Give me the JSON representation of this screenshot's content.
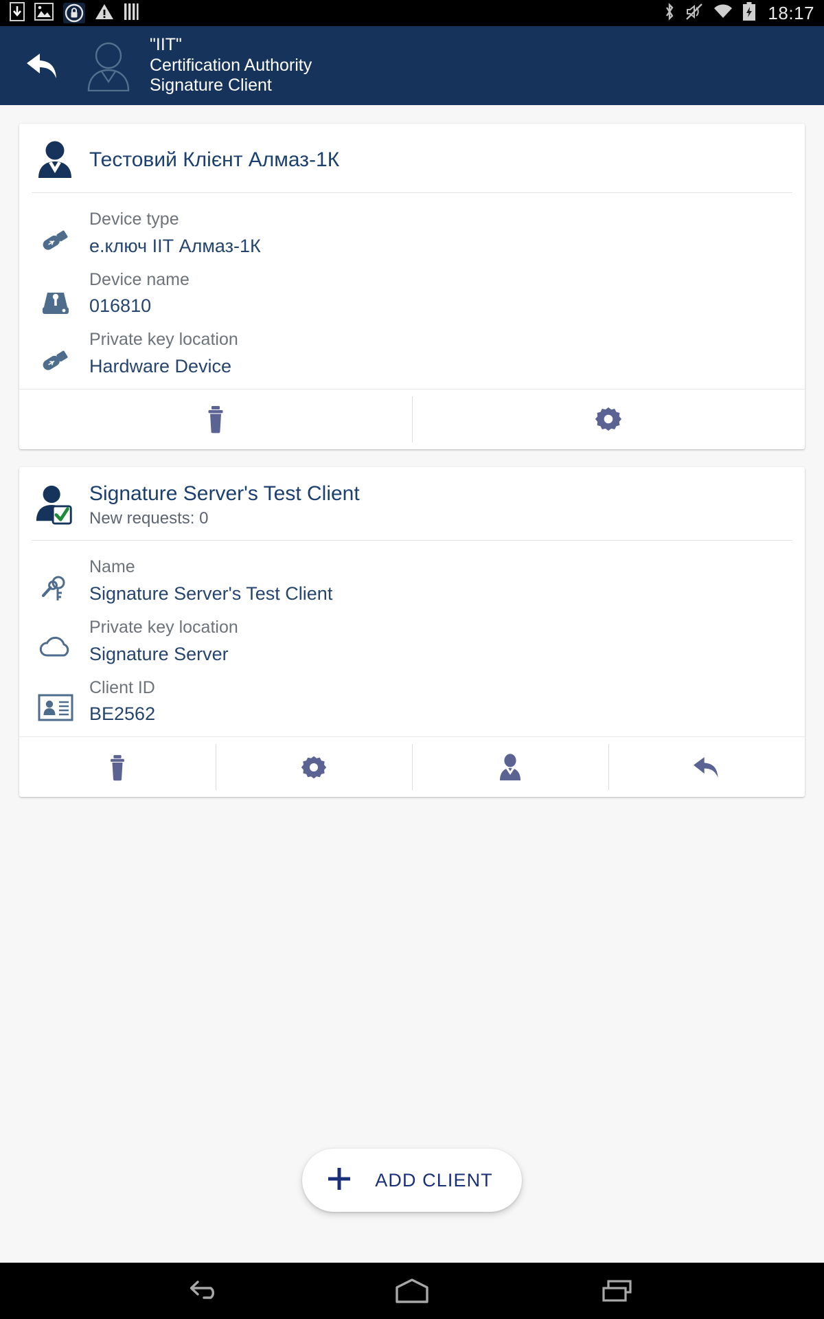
{
  "status_bar": {
    "time": "18:17",
    "left_icons": [
      "download-icon",
      "image-icon",
      "lock-icon",
      "warning-icon",
      "bars-icon"
    ],
    "right_icons": [
      "bluetooth-icon",
      "volume-muted-icon",
      "wifi-icon",
      "battery-charging-icon"
    ]
  },
  "app_bar": {
    "back_icon": "back-arrow-icon",
    "avatar_icon": "person-outline-icon",
    "title_line1": "\"IIT\"",
    "title_line2": "Certification Authority",
    "title_line3": "Signature Client"
  },
  "colors": {
    "app_bar": "#16335c",
    "page_background": "#f7f7f7",
    "card_background": "#ffffff",
    "title_blue": "#1b3f6e",
    "value_blue": "#25456e",
    "label_gray": "#6d737b",
    "action_icon": "#5a6391",
    "accent_blue": "#1a2f7a",
    "check_green": "#1e8a3c"
  },
  "cards": [
    {
      "id": "hardware-client-card",
      "icon": "person-filled-icon",
      "title": "Тестовий Клієнт Алмаз-1К",
      "subtitle": "",
      "rows": [
        {
          "icon": "usb-token-icon",
          "label": "Device type",
          "value": "е.ключ ІІТ Алмаз-1К"
        },
        {
          "icon": "key-drive-icon",
          "label": "Device name",
          "value": "016810"
        },
        {
          "icon": "usb-token-icon",
          "label": "Private key location",
          "value": "Hardware Device"
        }
      ],
      "actions": [
        {
          "icon": "trash-icon",
          "name": "delete-client-button"
        },
        {
          "icon": "gear-icon",
          "name": "settings-button"
        }
      ]
    },
    {
      "id": "signature-server-client-card",
      "icon": "person-verified-icon",
      "title": "Signature Server's Test Client",
      "subtitle": "New requests: 0",
      "rows": [
        {
          "icon": "keys-icon",
          "label": "Name",
          "value": "Signature Server's Test Client"
        },
        {
          "icon": "cloud-icon",
          "label": "Private key location",
          "value": "Signature Server"
        },
        {
          "icon": "id-card-icon",
          "label": "Client ID",
          "value": "BE2562"
        }
      ],
      "actions": [
        {
          "icon": "trash-icon",
          "name": "delete-client-button"
        },
        {
          "icon": "gear-icon",
          "name": "settings-button"
        },
        {
          "icon": "person-icon",
          "name": "client-profile-button"
        },
        {
          "icon": "reply-arrow-icon",
          "name": "share-button"
        }
      ]
    }
  ],
  "add_client": {
    "icon": "plus-icon",
    "label": "ADD CLIENT"
  },
  "nav_bar": {
    "buttons": [
      "back-nav-icon",
      "home-nav-icon",
      "recents-nav-icon"
    ]
  }
}
